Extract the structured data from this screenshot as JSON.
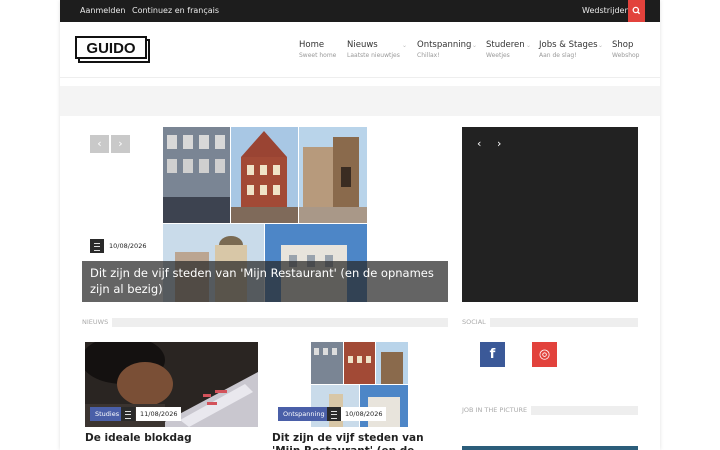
{
  "topbar": {
    "login": "Aanmelden",
    "french": "Continuez en français",
    "contests": "Wedstrijden"
  },
  "logo": {
    "text": "GUIDO"
  },
  "nav": [
    {
      "label": "Home",
      "sub": "Sweet home"
    },
    {
      "label": "Nieuws",
      "sub": "Laatste nieuwtjes"
    },
    {
      "label": "Ontspanning",
      "sub": "Chillax!"
    },
    {
      "label": "Studeren",
      "sub": "Weetjes"
    },
    {
      "label": "Jobs & Stages",
      "sub": "Aan de slag!"
    },
    {
      "label": "Shop",
      "sub": "Webshop"
    }
  ],
  "hero": {
    "date": "10/08/2026",
    "title": "Dit zijn de vijf steden van 'Mijn Restaurant' (en de opnames zijn al bezig)"
  },
  "sections": {
    "news": "NIEUWS",
    "social": "SOCIAL",
    "jobs": "JOB IN THE PICTURE"
  },
  "cards": [
    {
      "category": "Studies",
      "date": "11/08/2026",
      "title": "De ideale blokdag"
    },
    {
      "category": "Ontspanning",
      "date": "10/08/2026",
      "title": "Dit zijn de vijf steden van 'Mijn Restaurant' (en de"
    }
  ],
  "social": [
    {
      "icon": "facebook-icon",
      "glyph": "f",
      "color": "#3b5998"
    },
    {
      "icon": "instagram-icon",
      "glyph": "◎",
      "color": "#e2423c"
    }
  ],
  "colors": {
    "accent": "#e2423c",
    "category": "#4a5fa8",
    "topbar": "#1d1d1d"
  }
}
